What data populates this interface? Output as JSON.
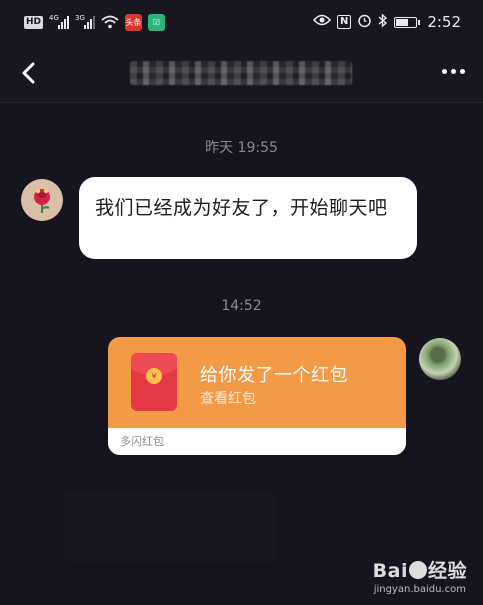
{
  "status_bar": {
    "hd_label": "HD",
    "signal1_label": "4G",
    "signal2_label": "3G",
    "app_badge_1": "头条",
    "app_badge_2": "☑",
    "nfc_label": "N",
    "time": "2:52",
    "battery_level": 0.65
  },
  "nav": {
    "back_icon": "chevron-left-icon",
    "more_icon": "more-dots-icon"
  },
  "messages": {
    "timestamp_1": "昨天 19:55",
    "friend_message": "我们已经成为好友了，开始聊天吧",
    "timestamp_2": "14:52"
  },
  "redpacket": {
    "title": "给你发了一个红包",
    "subtitle": "查看红包",
    "footer": "多闪红包",
    "coin_glyph": "¥"
  },
  "watermark": {
    "logo_pre": "Bai",
    "logo_post": "经验",
    "url": "jingyan.baidu.com"
  },
  "colors": {
    "background": "#16151f",
    "redpacket": "#f39a46",
    "envelope": "#e33a45"
  }
}
